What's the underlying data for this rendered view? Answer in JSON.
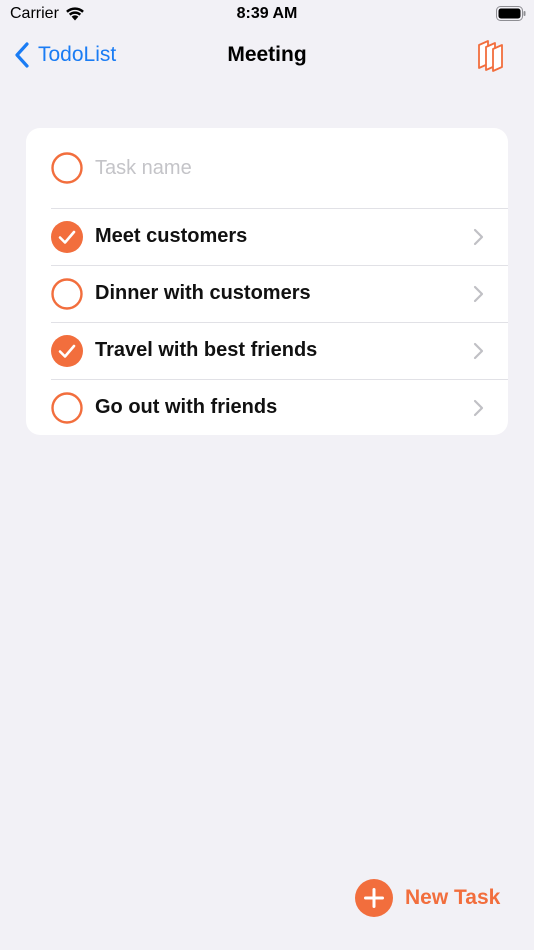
{
  "status_bar": {
    "carrier": "Carrier",
    "time": "8:39 AM"
  },
  "nav": {
    "back_label": "TodoList",
    "title": "Meeting"
  },
  "new_task_input": {
    "placeholder": "Task name",
    "value": ""
  },
  "tasks": [
    {
      "title": "Meet customers",
      "completed": true
    },
    {
      "title": "Dinner with customers",
      "completed": false
    },
    {
      "title": "Travel with best friends",
      "completed": true
    },
    {
      "title": "Go out with friends",
      "completed": false
    }
  ],
  "footer": {
    "new_task_label": "New Task"
  },
  "icons": {
    "back": "chevron-left-icon",
    "nav_action": "stacked-cards-icon",
    "check_done": "checkmark-circle-filled-icon",
    "check_empty": "empty-circle-icon",
    "disclosure": "chevron-right-icon",
    "add": "plus-circle-icon"
  },
  "colors": {
    "accent": "#f26e3d",
    "link": "#1a7cf4",
    "background": "#f2f1f6",
    "card": "#ffffff",
    "separator": "#e1e1e6",
    "placeholder": "#c4c4c8",
    "chevron": "#c0c0c5"
  }
}
